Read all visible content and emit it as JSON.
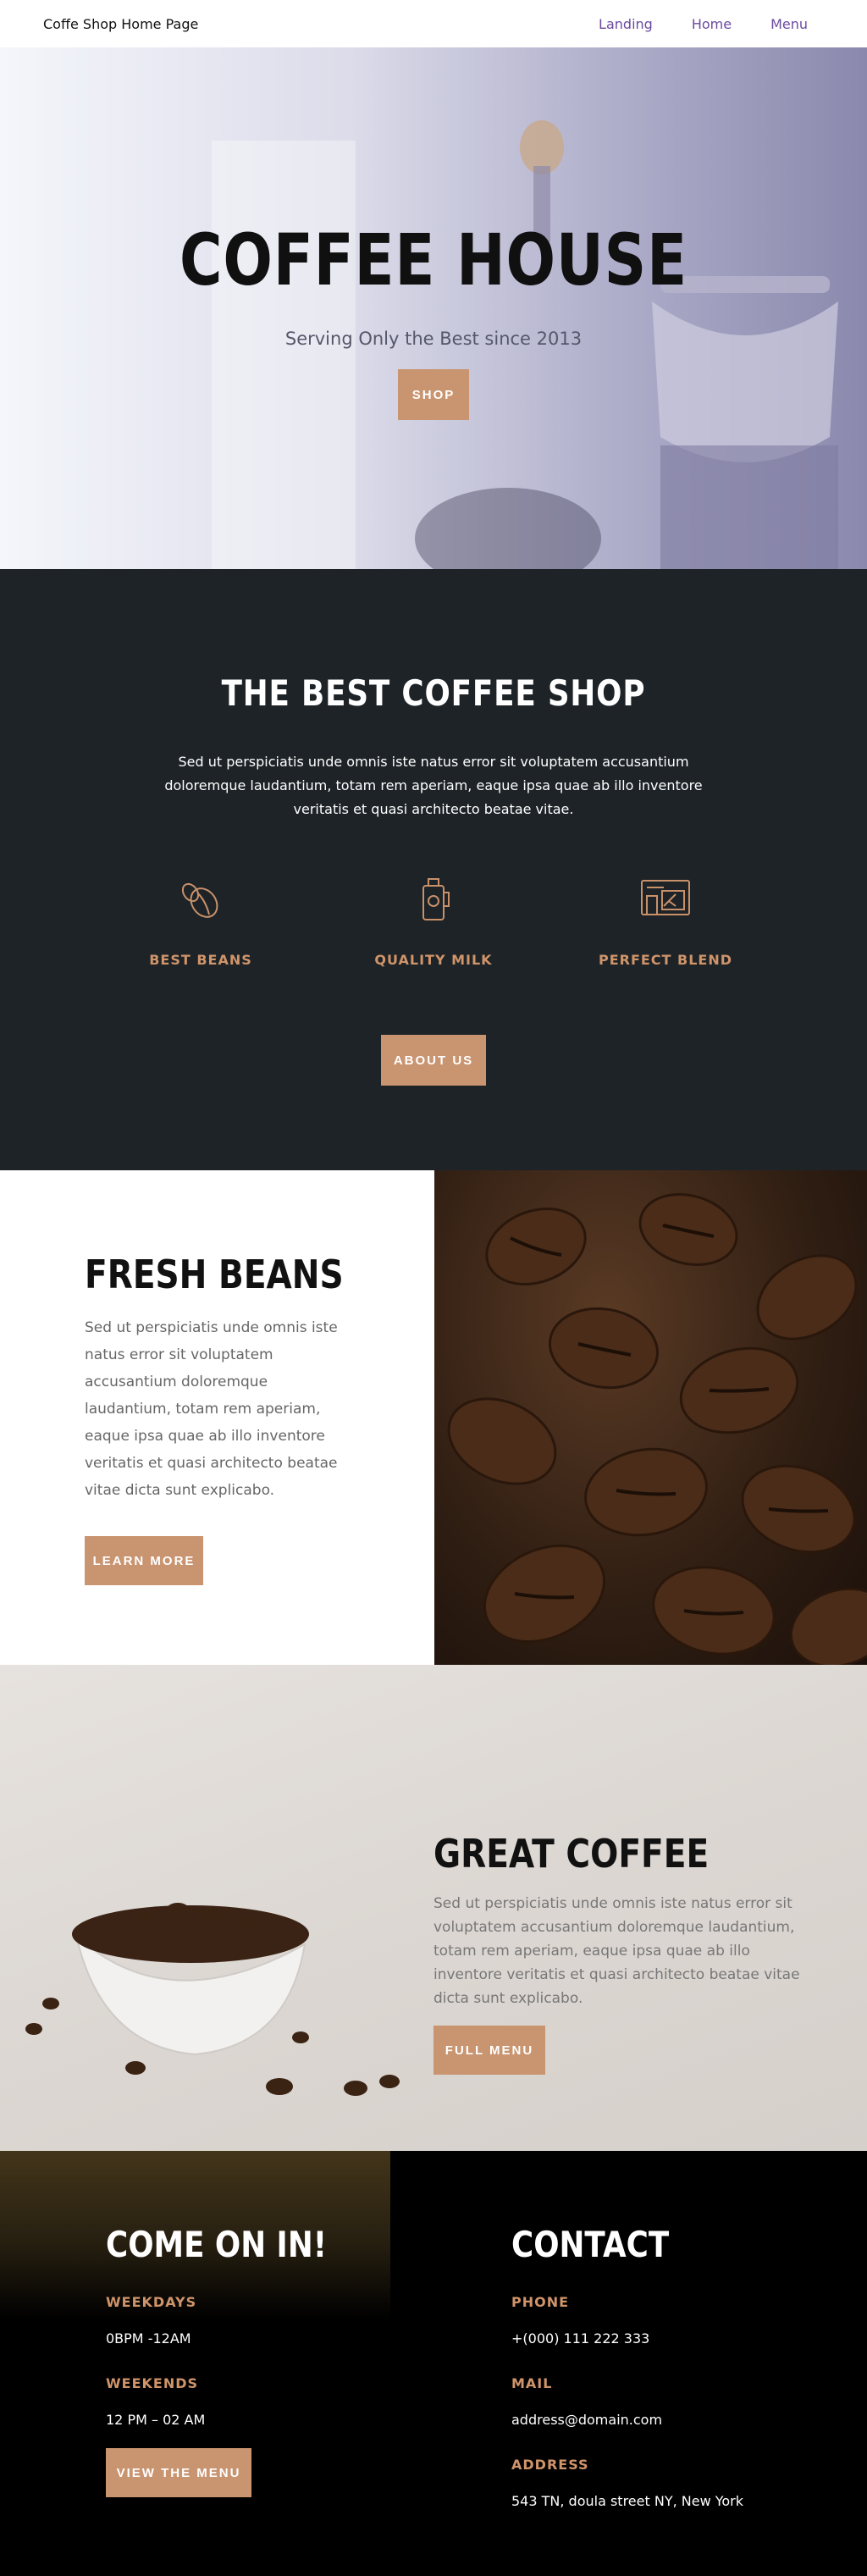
{
  "nav": {
    "brand": "Coffe Shop Home Page",
    "links": [
      "Landing",
      "Home",
      "Menu"
    ]
  },
  "hero": {
    "title": "COFFEE HOUSE",
    "subtitle": "Serving Only the Best since 2013",
    "button": "SHOP"
  },
  "intro": {
    "title": "THE BEST COFFEE SHOP",
    "text": "Sed ut perspiciatis unde omnis iste natus error sit voluptatem accusantium doloremque laudantium, totam rem aperiam, eaque ipsa quae ab illo inventore veritatis et quasi architecto beatae vitae.",
    "features": [
      {
        "label": "BEST BEANS",
        "icon": "coffee-bean-icon"
      },
      {
        "label": "QUALITY MILK",
        "icon": "milk-jug-icon"
      },
      {
        "label": "PERFECT BLEND",
        "icon": "coffee-machine-icon"
      }
    ],
    "button": "ABOUT US"
  },
  "fresh": {
    "title": "FRESH BEANS",
    "text": "Sed ut perspiciatis unde omnis iste natus error sit voluptatem accusantium doloremque laudantium, totam rem aperiam, eaque ipsa quae ab illo inventore veritatis et quasi architecto beatae vitae dicta sunt explicabo.",
    "button": "LEARN MORE"
  },
  "great": {
    "title": "GREAT COFFEE",
    "text": "Sed ut perspiciatis unde omnis iste natus error sit voluptatem accusantium doloremque laudantium, totam rem aperiam, eaque ipsa quae ab illo inventore veritatis et quasi architecto beatae vitae dicta sunt explicabo.",
    "button": "FULL MENU"
  },
  "footer": {
    "hours": {
      "title": "COME ON IN!",
      "weekdays_label": "WEEKDAYS",
      "weekdays_value": "0BPM -12AM",
      "weekends_label": "WEEKENDS",
      "weekends_value": "12 PM – 02 AM",
      "button": "VIEW THE MENU"
    },
    "contact": {
      "title": "CONTACT",
      "phone_label": "PHONE",
      "phone_value": "+(000) 111 222 333",
      "mail_label": "MAIL",
      "mail_value": "address@domain.com",
      "address_label": "ADDRESS",
      "address_value": "543 TN, doula street NY, New York"
    }
  },
  "colors": {
    "accent": "#c99470",
    "dark": "#1d2327",
    "nav_link": "#6b4aa0"
  }
}
